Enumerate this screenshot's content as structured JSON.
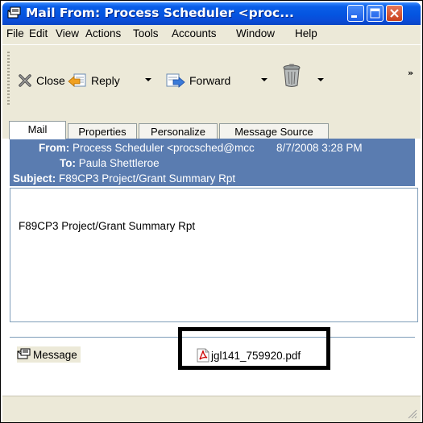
{
  "window": {
    "title": "Mail From: Process Scheduler <proc...",
    "minimize_icon": "minimize-icon",
    "maximize_icon": "maximize-icon",
    "close_icon": "close-icon"
  },
  "menu": {
    "items": [
      "File",
      "Edit",
      "View",
      "Actions",
      "Tools",
      "Accounts",
      "Window",
      "Help"
    ]
  },
  "toolbar": {
    "close_label": "Close",
    "reply_label": "Reply",
    "forward_label": "Forward",
    "overflow_glyph": "»"
  },
  "tabs": [
    "Mail",
    "Properties",
    "Personalize",
    "Message Source"
  ],
  "header": {
    "from_label": "From:",
    "from_value": "Process Scheduler <procsched@mcc",
    "date": "8/7/2008 3:28 PM",
    "to_label": "To:",
    "to_value": "Paula Shettleroe",
    "subject_label": "Subject:",
    "subject_value": "F89CP3  Project/Grant Summary Rpt"
  },
  "body": {
    "text": "F89CP3  Project/Grant Summary Rpt"
  },
  "attachments": {
    "message_label": "Message",
    "pdf_label": "jgl141_759920.pdf"
  },
  "colors": {
    "title_bar": "#0454e0",
    "header_bg": "#5a7cb0",
    "chrome": "#ece9d8"
  }
}
